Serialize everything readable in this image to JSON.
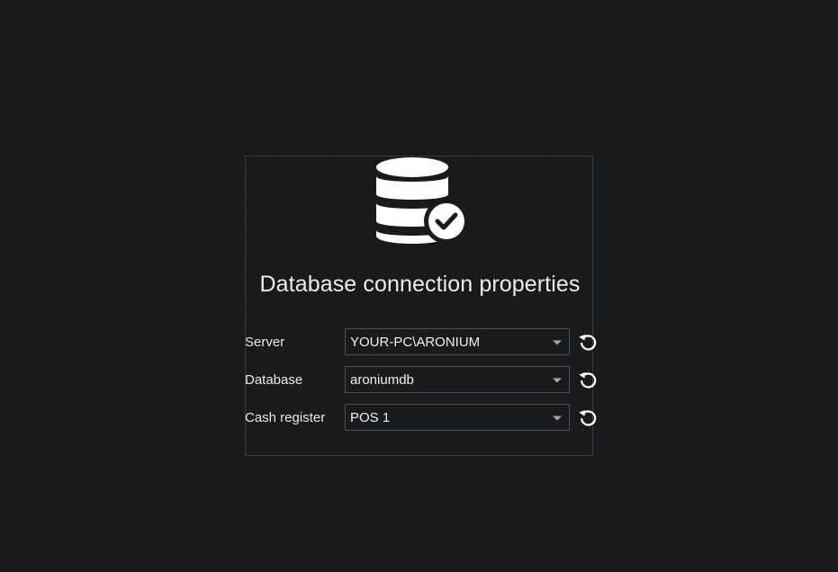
{
  "dialog": {
    "title": "Database connection properties",
    "icon": "database-check-icon"
  },
  "fields": [
    {
      "label": "Server",
      "value": "YOUR-PC\\ARONIUM"
    },
    {
      "label": "Database",
      "value": "aroniumdb"
    },
    {
      "label": "Cash register",
      "value": "POS 1"
    }
  ],
  "colors": {
    "background": "#181a1c",
    "text": "#e8e8e8",
    "border": "#4b4e52"
  }
}
